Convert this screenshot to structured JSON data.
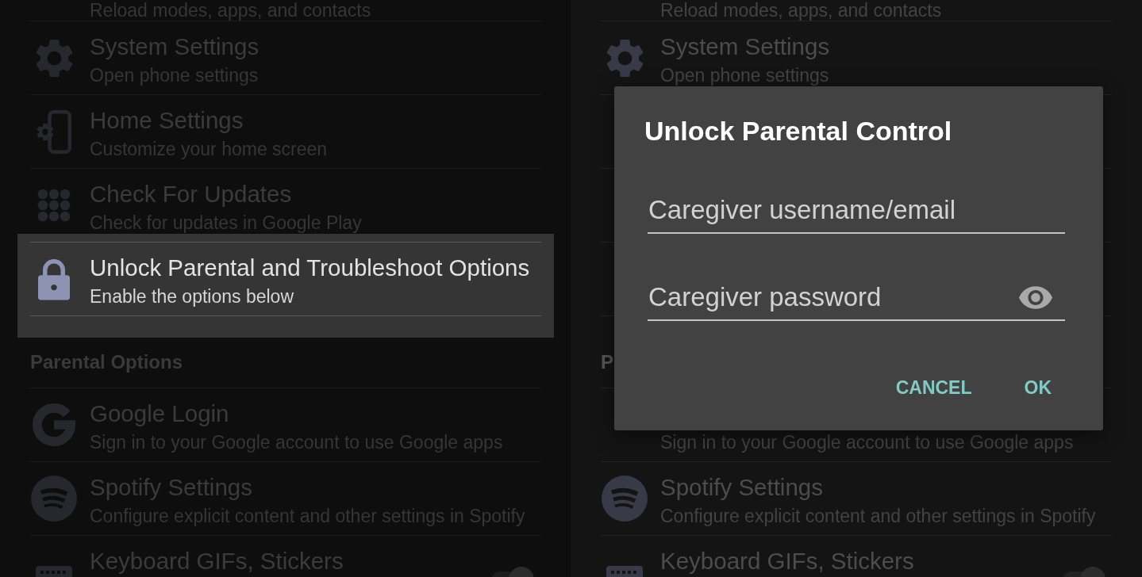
{
  "screens": [
    {
      "rows": [
        {
          "kind": "item",
          "subtitle": "Reload modes, apps, and contacts",
          "highlighted": false
        },
        {
          "kind": "item",
          "title": "System Settings",
          "subtitle": "Open phone settings",
          "highlighted": false
        },
        {
          "kind": "item",
          "title": "Home Settings",
          "subtitle": "Customize your home screen",
          "highlighted": false
        },
        {
          "kind": "item",
          "title": "Check For Updates",
          "subtitle": "Check for updates in Google Play",
          "highlighted": false
        },
        {
          "kind": "item",
          "title": "Unlock Parental and Troubleshoot Options",
          "subtitle": "Enable the options below",
          "highlighted": true
        },
        {
          "kind": "header",
          "label": "Parental Options"
        },
        {
          "kind": "item",
          "title": "Google Login",
          "subtitle": "Sign in to your Google account to use Google apps",
          "highlighted": false
        },
        {
          "kind": "item",
          "title": "Spotify Settings",
          "subtitle": "Configure explicit content and other settings in Spotify",
          "highlighted": false
        },
        {
          "kind": "toggle",
          "title": "Keyboard GIFs, Stickers",
          "highlighted": false,
          "on": true
        }
      ]
    },
    {
      "rows": [
        {
          "kind": "item",
          "subtitle": "Reload modes, apps, and contacts"
        },
        {
          "kind": "item",
          "title": "System Settings",
          "subtitle": "Open phone settings"
        },
        {
          "kind": "item"
        },
        {
          "kind": "item"
        },
        {
          "kind": "item"
        },
        {
          "kind": "header",
          "label": "P"
        },
        {
          "kind": "item",
          "subtitle": "Sign in to your Google account to use Google apps"
        },
        {
          "kind": "item",
          "title": "Spotify Settings",
          "subtitle": "Configure explicit content and other settings in Spotify"
        },
        {
          "kind": "toggle",
          "title": "Keyboard GIFs, Stickers",
          "on": true
        }
      ],
      "dialog": {
        "title": "Unlock Parental Control",
        "fields": [
          {
            "kind": "text",
            "placeholder": "Caregiver username/email"
          },
          {
            "kind": "password",
            "placeholder": "Caregiver password"
          }
        ],
        "buttons": [
          "CANCEL",
          "OK"
        ]
      }
    }
  ]
}
